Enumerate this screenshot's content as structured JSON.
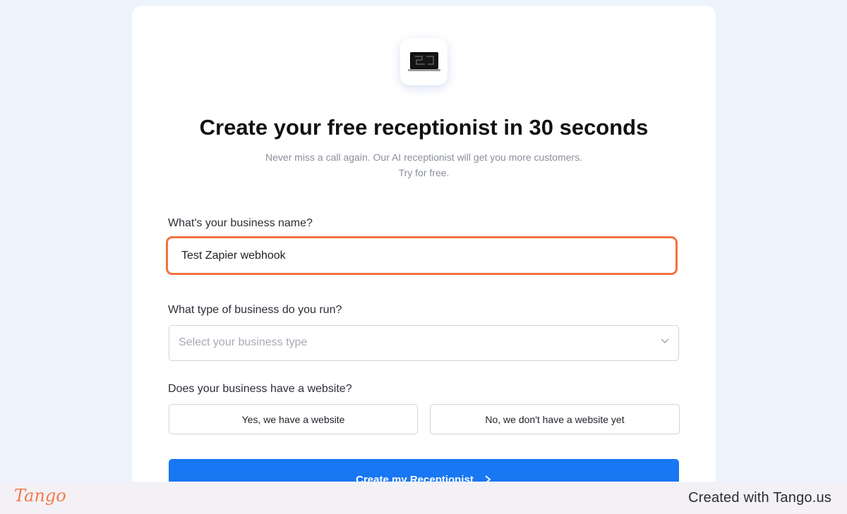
{
  "app": {
    "title": "Create your free receptionist in 30 seconds",
    "subtitle_line1": "Never miss a call again. Our AI receptionist will get you more customers.",
    "subtitle_line2": "Try for free.",
    "logo_icon": "laptop-icon"
  },
  "form": {
    "business_name": {
      "label": "What's your business name?",
      "value": "Test Zapier webhook"
    },
    "business_type": {
      "label": "What type of business do you run?",
      "placeholder": "Select your business type"
    },
    "website": {
      "label": "Does your business have a website?",
      "yes_label": "Yes, we have a website",
      "no_label": "No, we don't have a website yet"
    },
    "submit_label": "Create my Receptionist"
  },
  "footer": {
    "brand": "Tango",
    "credit": "Created with Tango.us"
  },
  "colors": {
    "accent": "#1877f2",
    "highlight": "#f07240",
    "background": "#eef4fc"
  }
}
